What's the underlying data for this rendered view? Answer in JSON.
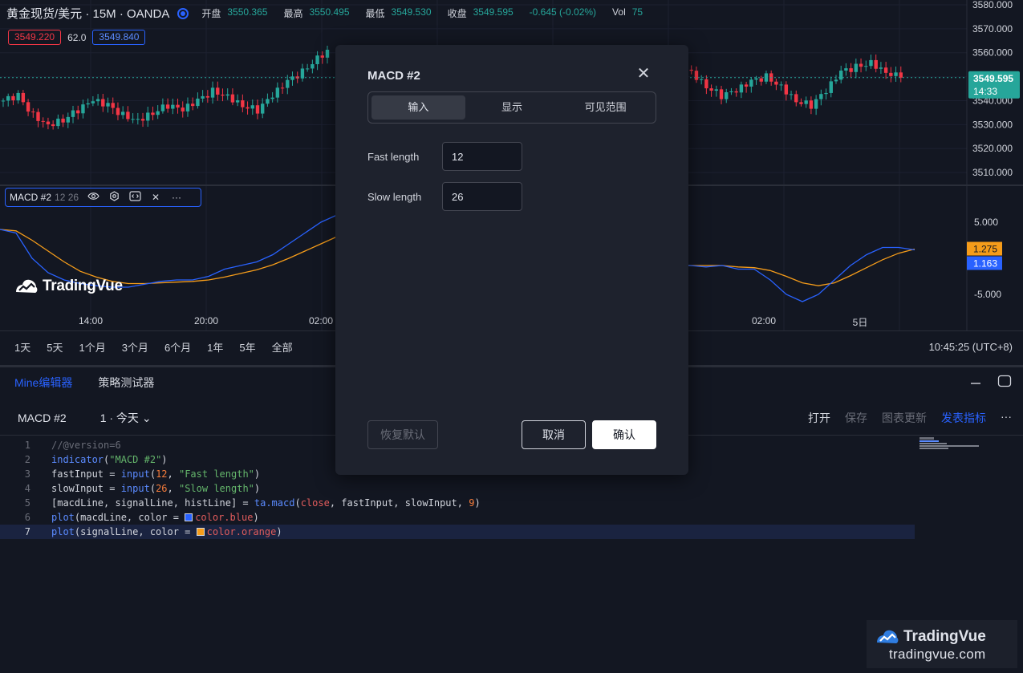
{
  "header": {
    "symbol": "黄金现货/美元 · 15M · OANDA",
    "ohlc": [
      {
        "label": "开盘",
        "value": "3550.365"
      },
      {
        "label": "最高",
        "value": "3550.495"
      },
      {
        "label": "最低",
        "value": "3549.530"
      },
      {
        "label": "收盘",
        "value": "3549.595"
      },
      {
        "label": "",
        "value": "-0.645 (-0.02%)"
      },
      {
        "label": "Vol",
        "value": "75"
      }
    ],
    "sell_price": "3549.220",
    "spread": "62.0",
    "buy_price": "3549.840"
  },
  "price_axis": {
    "ticks": [
      "3580.000",
      "3570.000",
      "3560.000",
      "3550.000",
      "3540.000",
      "3530.000",
      "3520.000",
      "3510.000"
    ],
    "current_price": "3549.595",
    "countdown": "14:33"
  },
  "macd_pane": {
    "name": "MACD #2",
    "params": "12 26",
    "axis_ticks": [
      "5.000",
      "-5.000"
    ],
    "signal_value": "1.275",
    "macd_value": "1.163"
  },
  "brand": {
    "name": "TradingVue"
  },
  "time_axis": [
    "14:00",
    "20:00",
    "02:00",
    "02:00",
    "5日"
  ],
  "ranges": [
    "1天",
    "5天",
    "1个月",
    "3个月",
    "6个月",
    "1年",
    "5年",
    "全部"
  ],
  "clock": "10:45:25 (UTC+8)",
  "editor": {
    "tabs": [
      "Mine编辑器",
      "策略测试器"
    ],
    "script_name": "MACD #2",
    "version": "1 · 今天",
    "actions": [
      "打开",
      "保存",
      "图表更新",
      "发表指标"
    ],
    "more": "···",
    "code_lines": [
      "//@version=6",
      "indicator(\"MACD #2\")",
      "fastInput = input(12, \"Fast length\")",
      "slowInput = input(26, \"Slow length\")",
      "[macdLine, signalLine, histLine] = ta.macd(close, fastInput, slowInput, 9)",
      "plot(macdLine, color = color.blue)",
      "plot(signalLine, color = color.orange)"
    ]
  },
  "watermark": {
    "name": "TradingVue",
    "url": "tradingvue.com"
  },
  "modal": {
    "title": "MACD #2",
    "tabs": [
      "输入",
      "显示",
      "可见范围"
    ],
    "fields": [
      {
        "label": "Fast length",
        "value": "12"
      },
      {
        "label": "Slow length",
        "value": "26"
      }
    ],
    "reset_label": "恢复默认",
    "cancel_label": "取消",
    "ok_label": "确认"
  },
  "colors": {
    "up": "#26a69a",
    "down": "#f23645",
    "macd": "#2962ff",
    "signal": "#f59c1a",
    "accent": "#2962ff"
  },
  "chart_data": {
    "type": "candlestick",
    "price_range": [
      3505,
      3582
    ],
    "close_series": [
      3540,
      3542,
      3534,
      3530,
      3532,
      3536,
      3540,
      3538,
      3534,
      3532,
      3535,
      3538,
      3536,
      3540,
      3544,
      3542,
      3538,
      3536,
      3542,
      3548,
      3552,
      3558,
      3562,
      3560,
      3556,
      3560,
      3564,
      3566,
      3570,
      3572,
      3576,
      3572,
      3566,
      3562,
      3558,
      3554,
      3550,
      3548,
      3546,
      3544,
      3540,
      3538,
      3542,
      3548,
      3554,
      3556,
      3552,
      3546,
      3542,
      3544,
      3548,
      3550,
      3546,
      3540,
      3538,
      3544,
      3552,
      3554,
      3556,
      3552,
      3549.6
    ],
    "macd_range": [
      -10,
      10
    ],
    "macd_series": [
      4,
      3.5,
      0,
      -2,
      -3,
      -3.5,
      -3.8,
      -4,
      -4,
      -3.6,
      -3.2,
      -3,
      -3,
      -2.5,
      -1.5,
      -1,
      -0.5,
      0.5,
      2,
      3.5,
      5,
      6,
      6.5,
      7,
      7.5,
      7.8,
      8,
      7.5,
      7,
      6.5,
      5,
      3,
      2,
      1,
      0,
      -1,
      -2,
      -2.5,
      -2,
      -1.5,
      -1,
      -0.5,
      -1,
      -1,
      -1.2,
      -1,
      -1.5,
      -1.5,
      -3,
      -5,
      -6,
      -5,
      -3,
      -1,
      0.5,
      1.5,
      1.5,
      1.163
    ],
    "signal_series": [
      4,
      3.8,
      2.5,
      1,
      -0.5,
      -1.8,
      -2.6,
      -3.2,
      -3.5,
      -3.5,
      -3.4,
      -3.3,
      -3.2,
      -3,
      -2.6,
      -2.1,
      -1.6,
      -0.9,
      0,
      1,
      2,
      3,
      4,
      4.8,
      5.5,
      6,
      6.5,
      6.8,
      6.9,
      6.8,
      6.3,
      5.6,
      4.8,
      3.9,
      3,
      2,
      1,
      0.2,
      -0.4,
      -0.8,
      -1,
      -0.9,
      -0.9,
      -1,
      -1,
      -1,
      -1.2,
      -1.3,
      -1.7,
      -2.5,
      -3.4,
      -3.8,
      -3.4,
      -2.4,
      -1.3,
      -0.2,
      0.7,
      1.275
    ]
  }
}
